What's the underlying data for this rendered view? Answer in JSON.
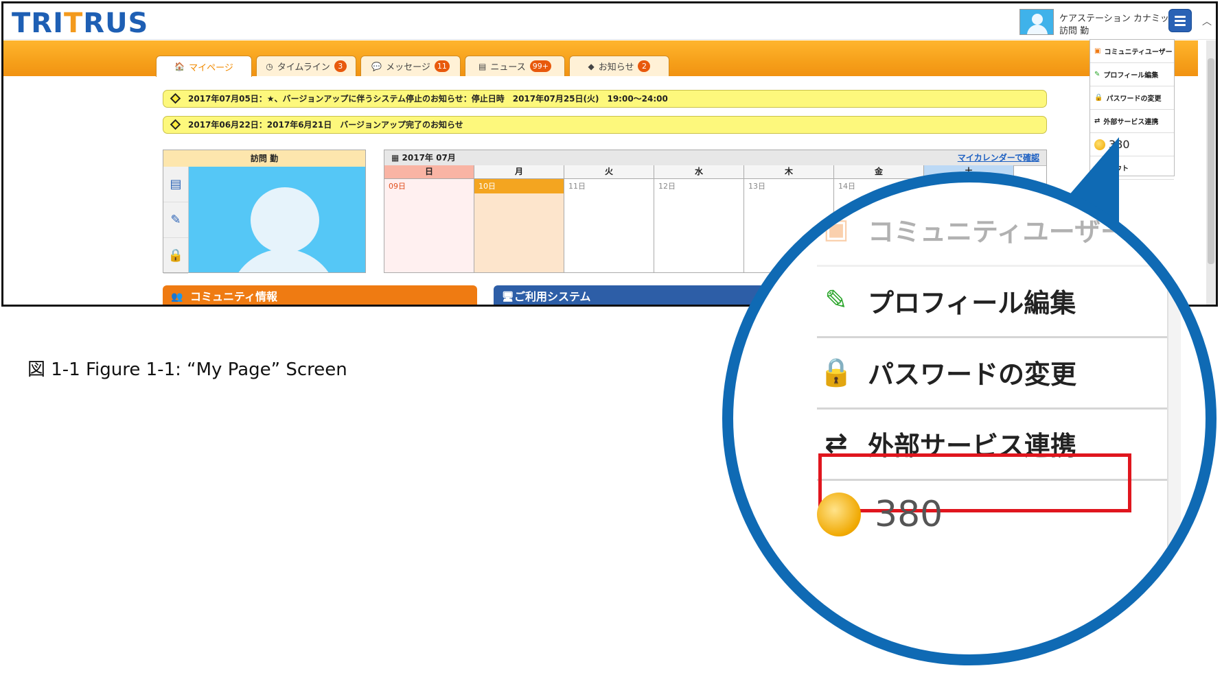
{
  "app": {
    "logo_part1": "TRI",
    "logo_part2": "T",
    "logo_part3": "RUS"
  },
  "user": {
    "org": "ケアステーション カナミック",
    "name": "訪問 勤"
  },
  "tabs": [
    {
      "label": "マイページ",
      "badge": "",
      "icon": "home-icon"
    },
    {
      "label": "タイムライン",
      "badge": "3",
      "icon": "clock-icon"
    },
    {
      "label": "メッセージ",
      "badge": "11",
      "icon": "chat-icon"
    },
    {
      "label": "ニュース",
      "badge": "99+",
      "icon": "news-icon"
    },
    {
      "label": "お知らせ",
      "badge": "2",
      "icon": "notice-icon"
    }
  ],
  "notices": [
    "2017年07月05日：★、バージョンアップに伴うシステム停止のお知らせ：停止日時　2017年07月25日(火)　19:00〜24:00",
    "2017年06月22日：2017年6月21日　バージョンアップ完了のお知らせ"
  ],
  "profile": {
    "title": "訪問 勤"
  },
  "calendar": {
    "month": "2017年 07月",
    "link": "マイカレンダーで確認",
    "days": [
      {
        "dow": "日",
        "date": "09日"
      },
      {
        "dow": "月",
        "date": "10日"
      },
      {
        "dow": "火",
        "date": "11日"
      },
      {
        "dow": "水",
        "date": "12日"
      },
      {
        "dow": "木",
        "date": "13日"
      },
      {
        "dow": "金",
        "date": "14日"
      },
      {
        "dow": "土",
        "date": ""
      }
    ]
  },
  "sections": {
    "community": "コミュニティ情報",
    "systems": "ご利用システム"
  },
  "dropdown": {
    "items": [
      "コミュニティユーザー",
      "プロフィール編集",
      "パスワードの変更",
      "外部サービス連携",
      "380",
      "ログアウト"
    ]
  },
  "zoom": {
    "items": [
      "コミュニティユーザー",
      "プロフィール編集",
      "パスワードの変更",
      "外部サービス連携",
      "380"
    ]
  },
  "caption": "図 1-1 Figure 1-1: “My Page” Screen",
  "colors": {
    "accent_orange": "#f6a01a",
    "brand_blue": "#1e5fb4",
    "highlight_red": "#e0161e",
    "magnifier_blue": "#0f6ab4"
  }
}
